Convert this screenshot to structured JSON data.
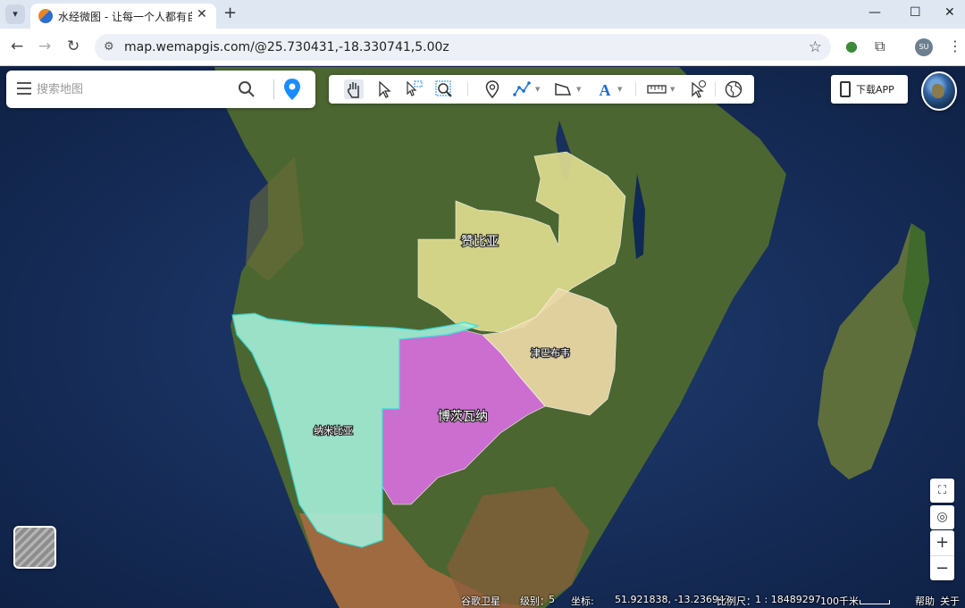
{
  "browser": {
    "tab_title": "水经微图 - 让每一个人都有自己",
    "url": "map.wemapgis.com/@25.730431,-18.330741,5.00z",
    "profile_initials": "SU"
  },
  "search": {
    "placeholder": "搜索地图"
  },
  "download": {
    "label": "下载APP"
  },
  "countries": [
    {
      "name": "赞比亚",
      "color": "#dedd8f"
    },
    {
      "name": "津巴布韦",
      "color": "#ecd9a8"
    },
    {
      "name": "博茨瓦纳",
      "color": "#d36ed9"
    },
    {
      "name": "纳米比亚",
      "color": "#a6f2de"
    }
  ],
  "status": {
    "layer": "谷歌卫星",
    "level_label": "级别：",
    "level": "5",
    "coord_label": "坐标:",
    "coords": "51.921838, -13.236943",
    "scale_label": "比例尺：",
    "scale": "1 : 18489297",
    "scale_bar": "100千米",
    "help": "帮助",
    "about": "关于"
  },
  "colors": {
    "ocean": "#14274d",
    "land_green": "#4d6a2f",
    "land_desert": "#b8764a",
    "accent": "#1a8cff"
  },
  "icons": {
    "layer_switch": "layers-icon",
    "fullscreen": "fullscreen-icon",
    "locate": "locate-icon"
  }
}
